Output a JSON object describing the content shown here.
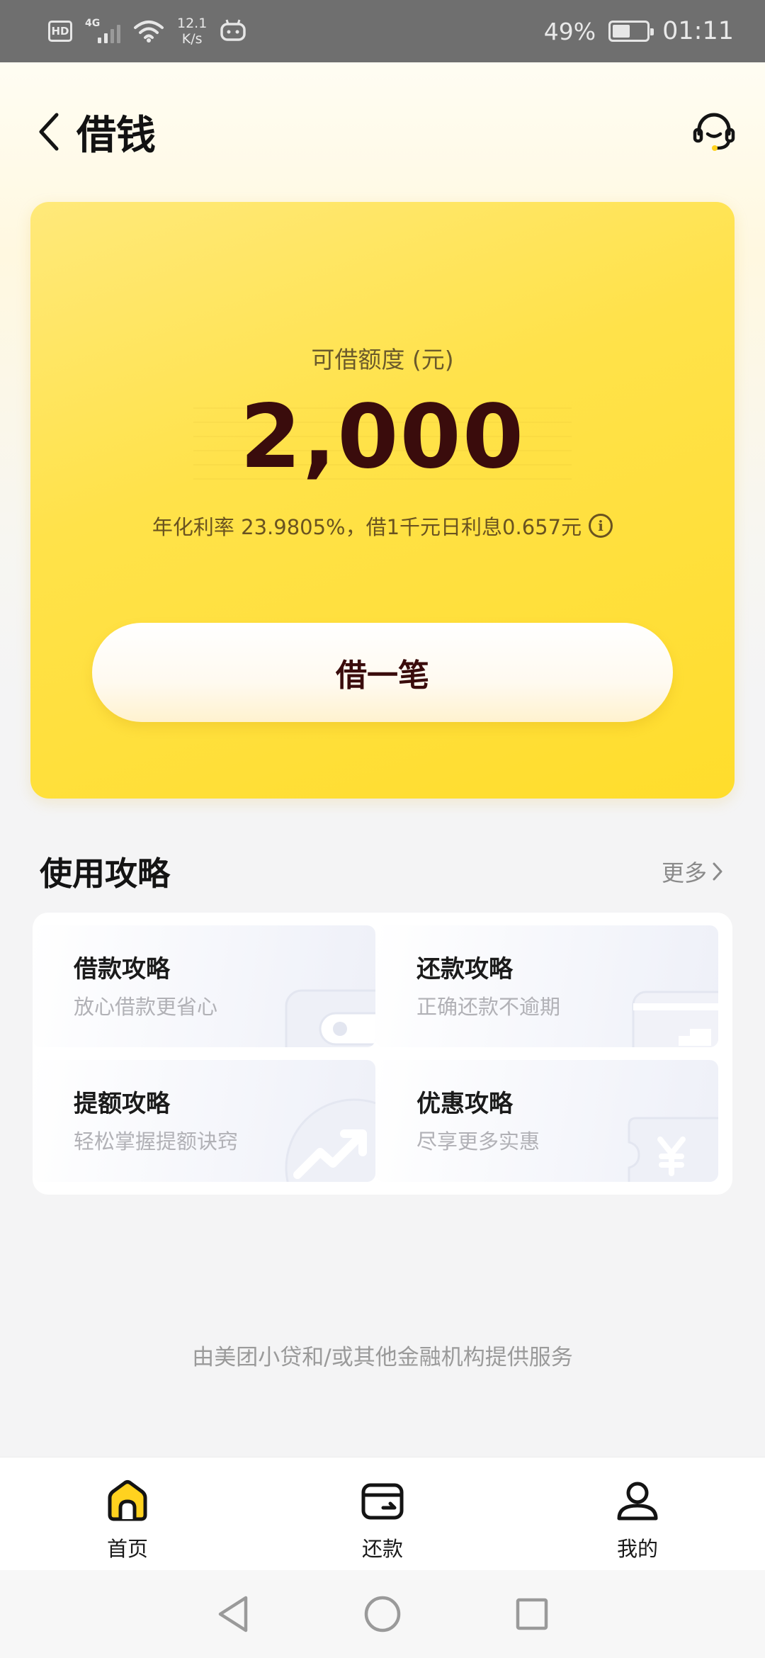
{
  "status_bar": {
    "hd": "HD",
    "network": "4G",
    "speed_value": "12.1",
    "speed_unit": "K/s",
    "battery_percent": "49%",
    "battery_level": 0.49,
    "time": "01:11"
  },
  "header": {
    "title": "借钱",
    "back_icon": "chevron-left-icon",
    "service_icon": "headset-icon"
  },
  "credit": {
    "label": "可借额度 (元)",
    "amount": "2,000",
    "rate_text": "年化利率 23.9805%，借1千元日利息0.657元",
    "borrow_label": "借一笔"
  },
  "guides": {
    "title": "使用攻略",
    "more_label": "更多",
    "items": [
      {
        "title": "借款攻略",
        "subtitle": "放心借款更省心",
        "icon": "wallet-icon"
      },
      {
        "title": "还款攻略",
        "subtitle": "正确还款不逾期",
        "icon": "card-icon"
      },
      {
        "title": "提额攻略",
        "subtitle": "轻松掌握提额诀窍",
        "icon": "trend-up-icon"
      },
      {
        "title": "优惠攻略",
        "subtitle": "尽享更多实惠",
        "icon": "yen-ticket-icon"
      }
    ]
  },
  "footer": {
    "provider_text": "由美团小贷和/或其他金融机构提供服务"
  },
  "bottom_nav": {
    "items": [
      {
        "label": "首页",
        "icon": "home-icon",
        "active": true
      },
      {
        "label": "还款",
        "icon": "wallet-icon",
        "active": false
      },
      {
        "label": "我的",
        "icon": "user-icon",
        "active": false
      }
    ]
  },
  "colors": {
    "accent_yellow": "#ffdd2c",
    "amount_text": "#3a0c0c",
    "muted_text": "#9a9a9a"
  }
}
